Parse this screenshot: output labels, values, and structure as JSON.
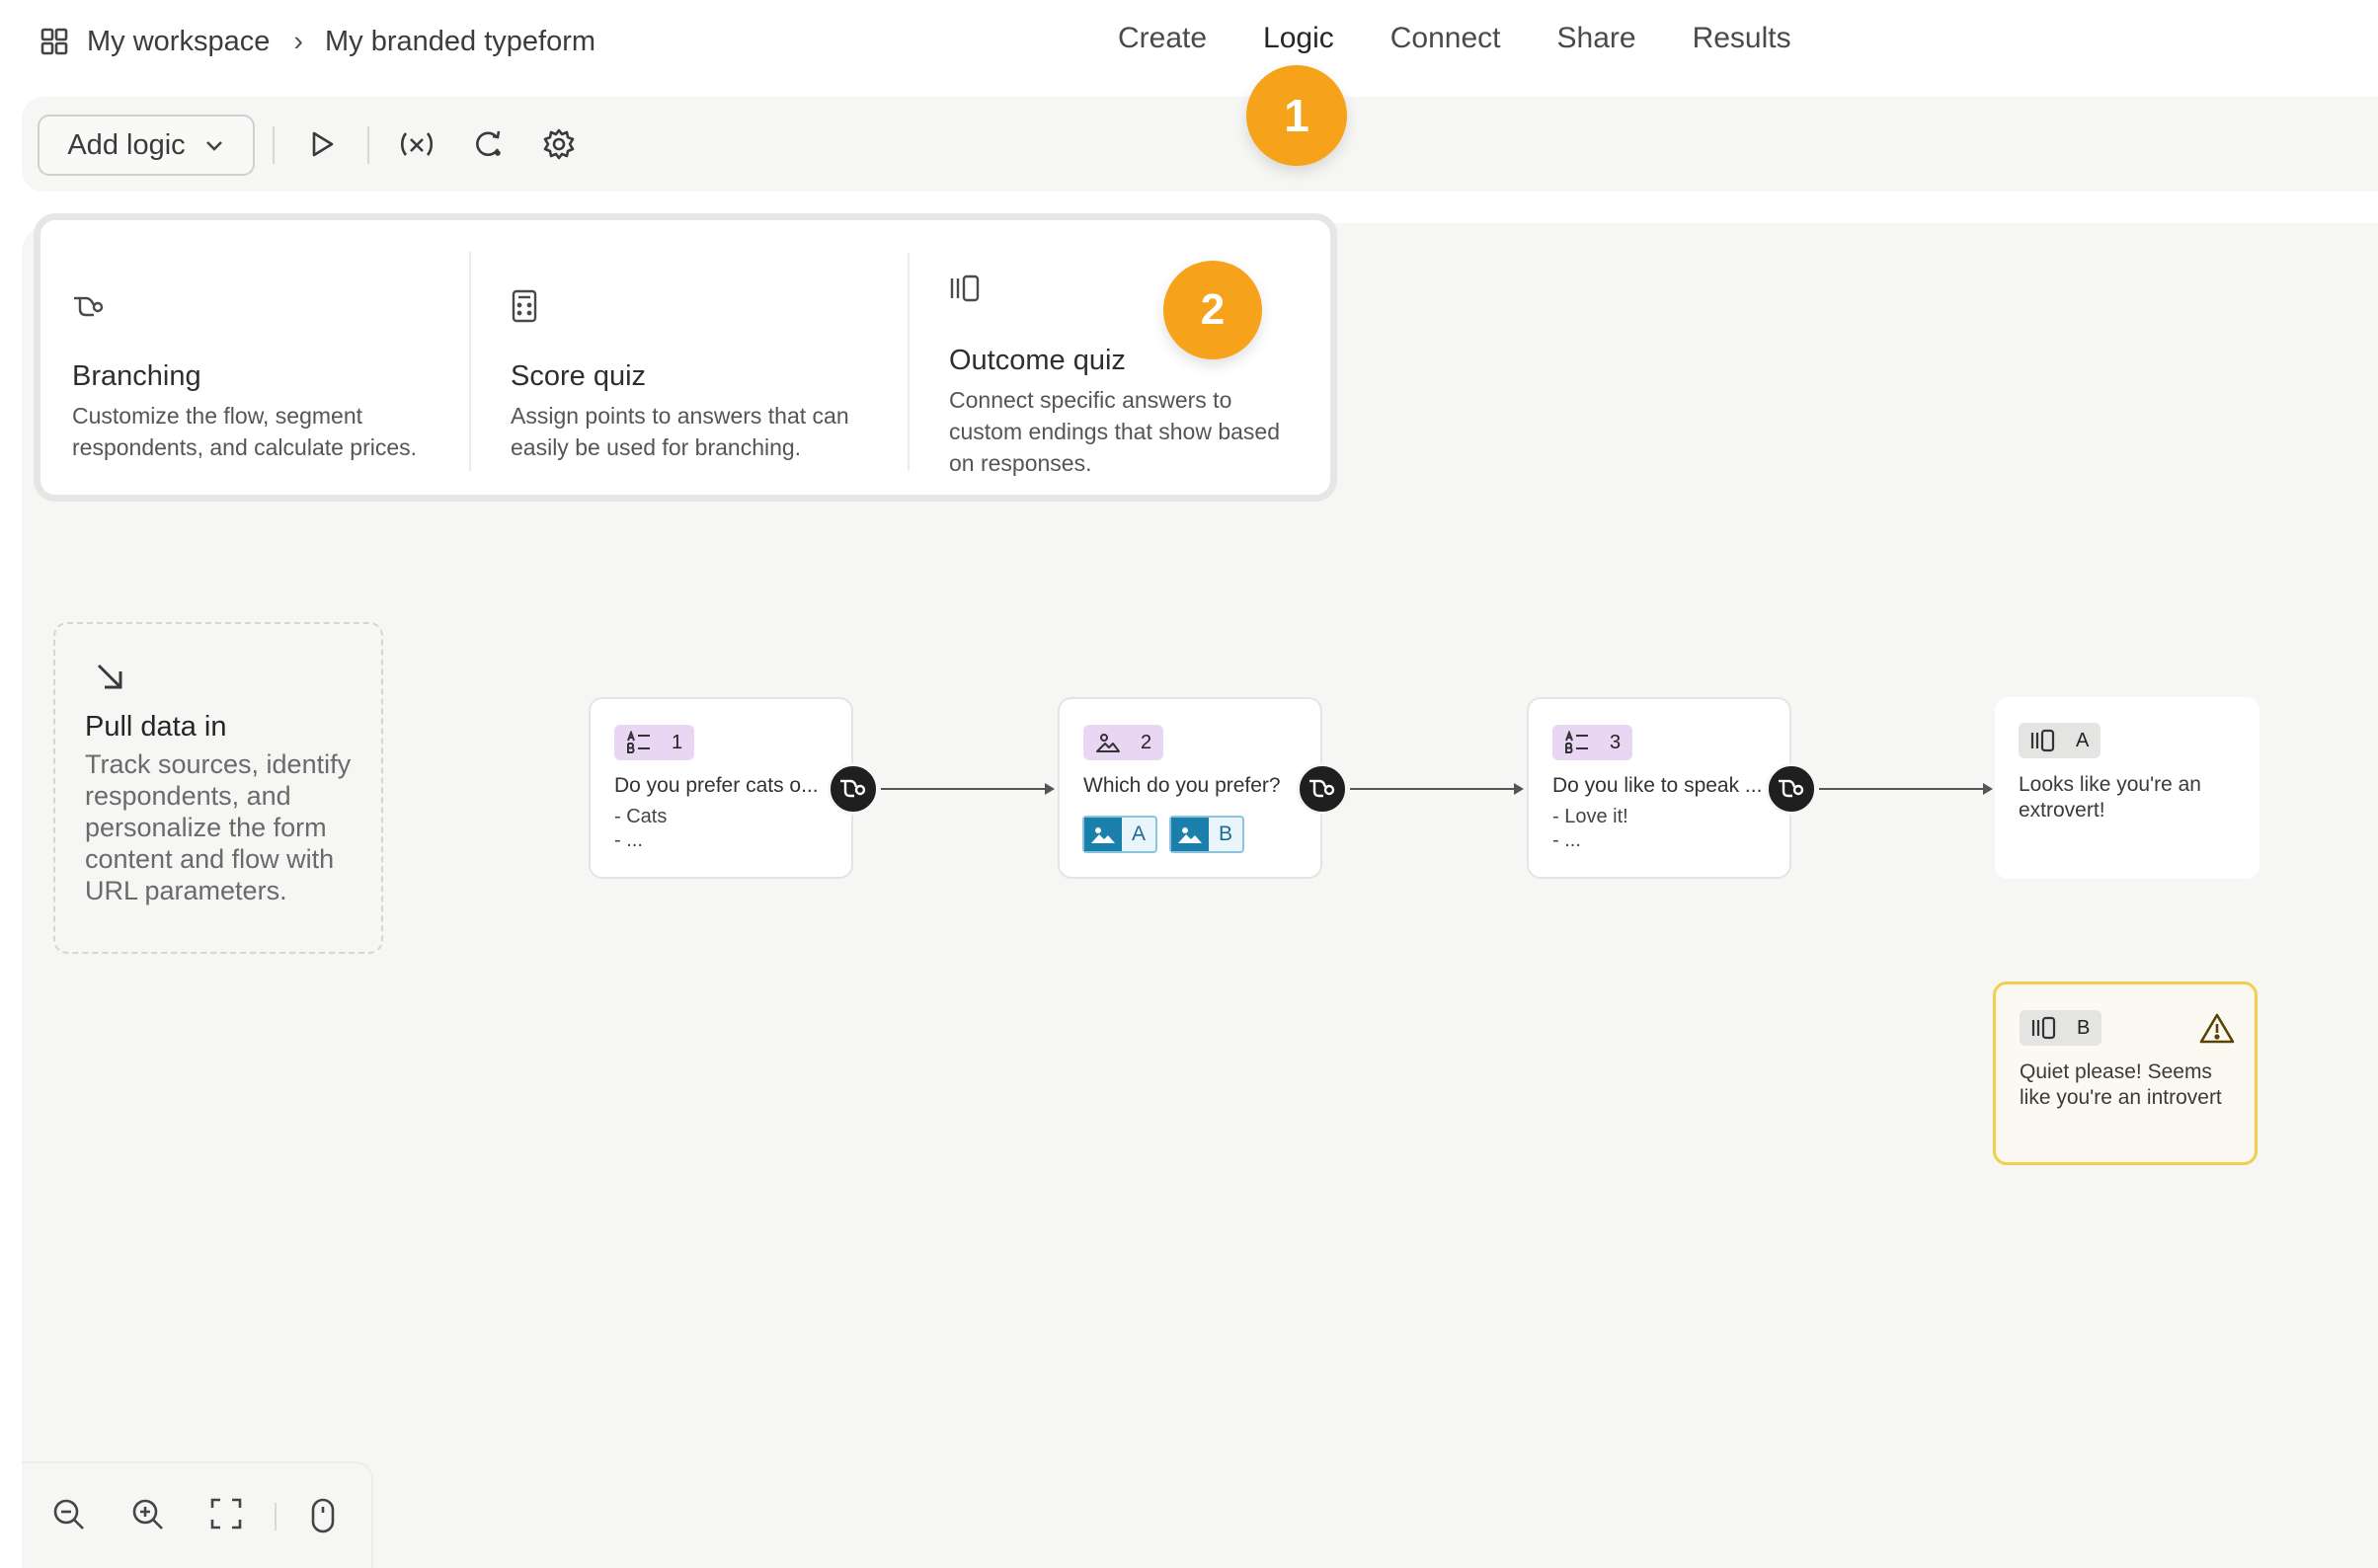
{
  "breadcrumb": {
    "workspace": "My workspace",
    "separator": "›",
    "form": "My branded typeform"
  },
  "tabs": [
    "Create",
    "Logic",
    "Connect",
    "Share",
    "Results"
  ],
  "active_tab": "Logic",
  "toolbar": {
    "add_logic_label": "Add logic"
  },
  "badges": {
    "one": "1",
    "two": "2"
  },
  "logic_menu": {
    "branching": {
      "title": "Branching",
      "desc": "Customize the flow, segment respondents, and calculate prices."
    },
    "score_quiz": {
      "title": "Score quiz",
      "desc": "Assign points to answers that can easily be used for branching."
    },
    "outcome_quiz": {
      "title": "Outcome quiz",
      "desc": "Connect specific answers to custom endings that show based on responses."
    }
  },
  "pull_data": {
    "title": "Pull data in",
    "desc": "Track sources, identify respondents, and personalize the form content and flow with URL parameters."
  },
  "nodes": [
    {
      "num": "1",
      "question": "Do you prefer cats o...",
      "answer1": "- Cats",
      "answer2": "- ..."
    },
    {
      "num": "2",
      "question": "Which do you prefer?",
      "choice_a": "A",
      "choice_b": "B"
    },
    {
      "num": "3",
      "question": "Do you like to speak ...",
      "answer1": "- Love it!",
      "answer2": "- ..."
    }
  ],
  "endings": [
    {
      "letter": "A",
      "text": "Looks like you're an extrovert!"
    },
    {
      "letter": "B",
      "text": "Quiet please! Seems like you're an introvert"
    }
  ],
  "colors": {
    "accent_badge": "#f7a21b",
    "question_tag": "#e9d6f3",
    "ending_warning_border": "#f0cf4a",
    "picture_choice": "#1a7fab"
  },
  "icons": [
    "grid-icon",
    "chevron-down-icon",
    "play-icon",
    "variable-icon",
    "loop-icon",
    "gear-icon",
    "branch-icon",
    "calculator-icon",
    "outcome-icon",
    "arrow-down-right-icon",
    "warning-icon",
    "zoom-out-icon",
    "zoom-in-icon",
    "fit-screen-icon",
    "mouse-icon"
  ]
}
